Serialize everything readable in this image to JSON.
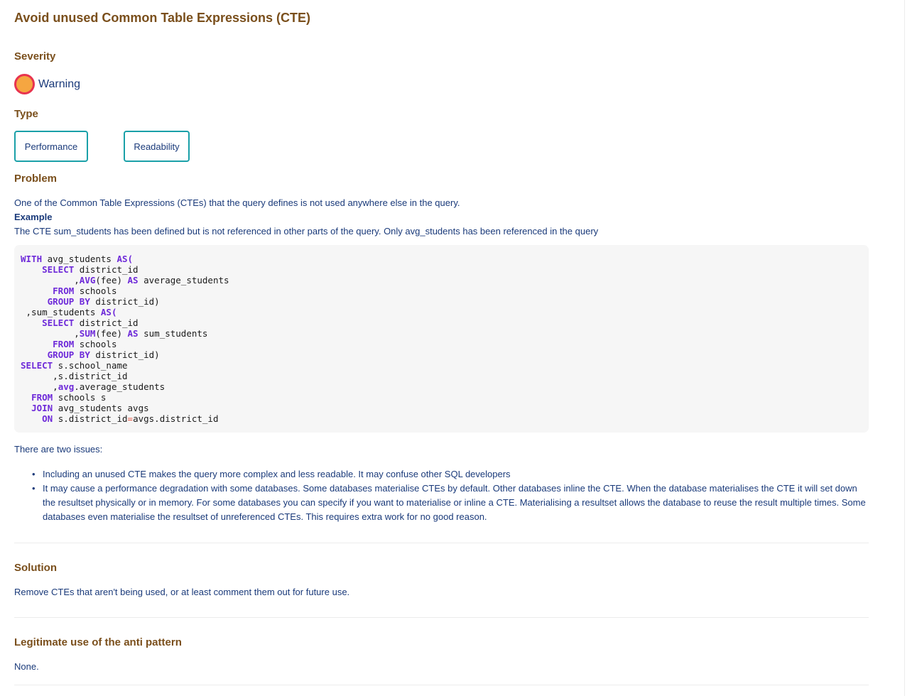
{
  "page": {
    "title": "Avoid unused Common Table Expressions (CTE)"
  },
  "severity": {
    "heading": "Severity",
    "icon": "warning-circle-icon",
    "label": "Warning",
    "colors": {
      "fill": "#f5a641",
      "ring": "#e8334f"
    }
  },
  "type": {
    "heading": "Type",
    "tags": [
      {
        "label": "Performance"
      },
      {
        "label": "Readability"
      }
    ]
  },
  "problem": {
    "heading": "Problem",
    "description": "One of the Common Table Expressions (CTEs) that the query defines is not used anywhere else in the query.",
    "example_label": "Example",
    "example_text": "The CTE sum_students has been defined but is not referenced in other parts of the query. Only avg_students has been referenced in the query",
    "code_lines": [
      [
        {
          "t": "WITH",
          "k": 1
        },
        {
          "t": " avg_students "
        },
        {
          "t": "AS(",
          "k": 1
        }
      ],
      [
        {
          "t": "    "
        },
        {
          "t": "SELECT",
          "k": 1
        },
        {
          "t": " district_id"
        }
      ],
      [
        {
          "t": "          ,"
        },
        {
          "t": "AVG",
          "k": 1
        },
        {
          "t": "(fee) "
        },
        {
          "t": "AS",
          "k": 1
        },
        {
          "t": " average_students"
        }
      ],
      [
        {
          "t": "      "
        },
        {
          "t": "FROM",
          "k": 1
        },
        {
          "t": " schools"
        }
      ],
      [
        {
          "t": "     "
        },
        {
          "t": "GROUP BY",
          "k": 1
        },
        {
          "t": " district_id)"
        }
      ],
      [
        {
          "t": " ,sum_students "
        },
        {
          "t": "AS(",
          "k": 1
        }
      ],
      [
        {
          "t": "    "
        },
        {
          "t": "SELECT",
          "k": 1
        },
        {
          "t": " district_id"
        }
      ],
      [
        {
          "t": "          ,"
        },
        {
          "t": "SUM",
          "k": 1
        },
        {
          "t": "(fee) "
        },
        {
          "t": "AS",
          "k": 1
        },
        {
          "t": " sum_students"
        }
      ],
      [
        {
          "t": "      "
        },
        {
          "t": "FROM",
          "k": 1
        },
        {
          "t": " schools"
        }
      ],
      [
        {
          "t": "     "
        },
        {
          "t": "GROUP BY",
          "k": 1
        },
        {
          "t": " district_id)"
        }
      ],
      [
        {
          "t": "SELECT",
          "k": 1
        },
        {
          "t": " s.school_name"
        }
      ],
      [
        {
          "t": "      ,s.district_id"
        }
      ],
      [
        {
          "t": "      ,"
        },
        {
          "t": "avg",
          "k": 1
        },
        {
          "t": ".average_students"
        }
      ],
      [
        {
          "t": "  "
        },
        {
          "t": "FROM",
          "k": 1
        },
        {
          "t": " schools s"
        }
      ],
      [
        {
          "t": "  "
        },
        {
          "t": "JOIN",
          "k": 1
        },
        {
          "t": " avg_students avgs"
        }
      ],
      [
        {
          "t": "    "
        },
        {
          "t": "ON",
          "k": 1
        },
        {
          "t": " s.district_id"
        },
        {
          "t": "=",
          "o": 1
        },
        {
          "t": "avgs.district_id"
        }
      ]
    ],
    "issues_intro": "There are two issues:",
    "issues": [
      "Including an unused CTE makes the query more complex and less readable. It may confuse other SQL developers",
      "It may cause a performance degradation with some databases. Some databases materialise CTEs by default. Other databases inline the CTE. When the database materialises the CTE it will set down the resultset physically or in memory. For some databases you can specify if you want to materialise or inline a CTE. Materialising a resultset allows the database to reuse the result multiple times. Some databases even materialise the resultset of unreferenced CTEs. This requires extra work for no good reason."
    ]
  },
  "solution": {
    "heading": "Solution",
    "text": "Remove CTEs that aren't being used, or at least comment them out for future use."
  },
  "legitimate_use": {
    "heading": "Legitimate use of the anti pattern",
    "text": "None."
  },
  "colors": {
    "heading": "#7a4f1c",
    "body_text": "#1a3a7a",
    "tag_border": "#1aa0a8",
    "code_keyword": "#6e2ad9",
    "code_operator": "#e8523e",
    "code_bg": "#f6f6f6"
  }
}
